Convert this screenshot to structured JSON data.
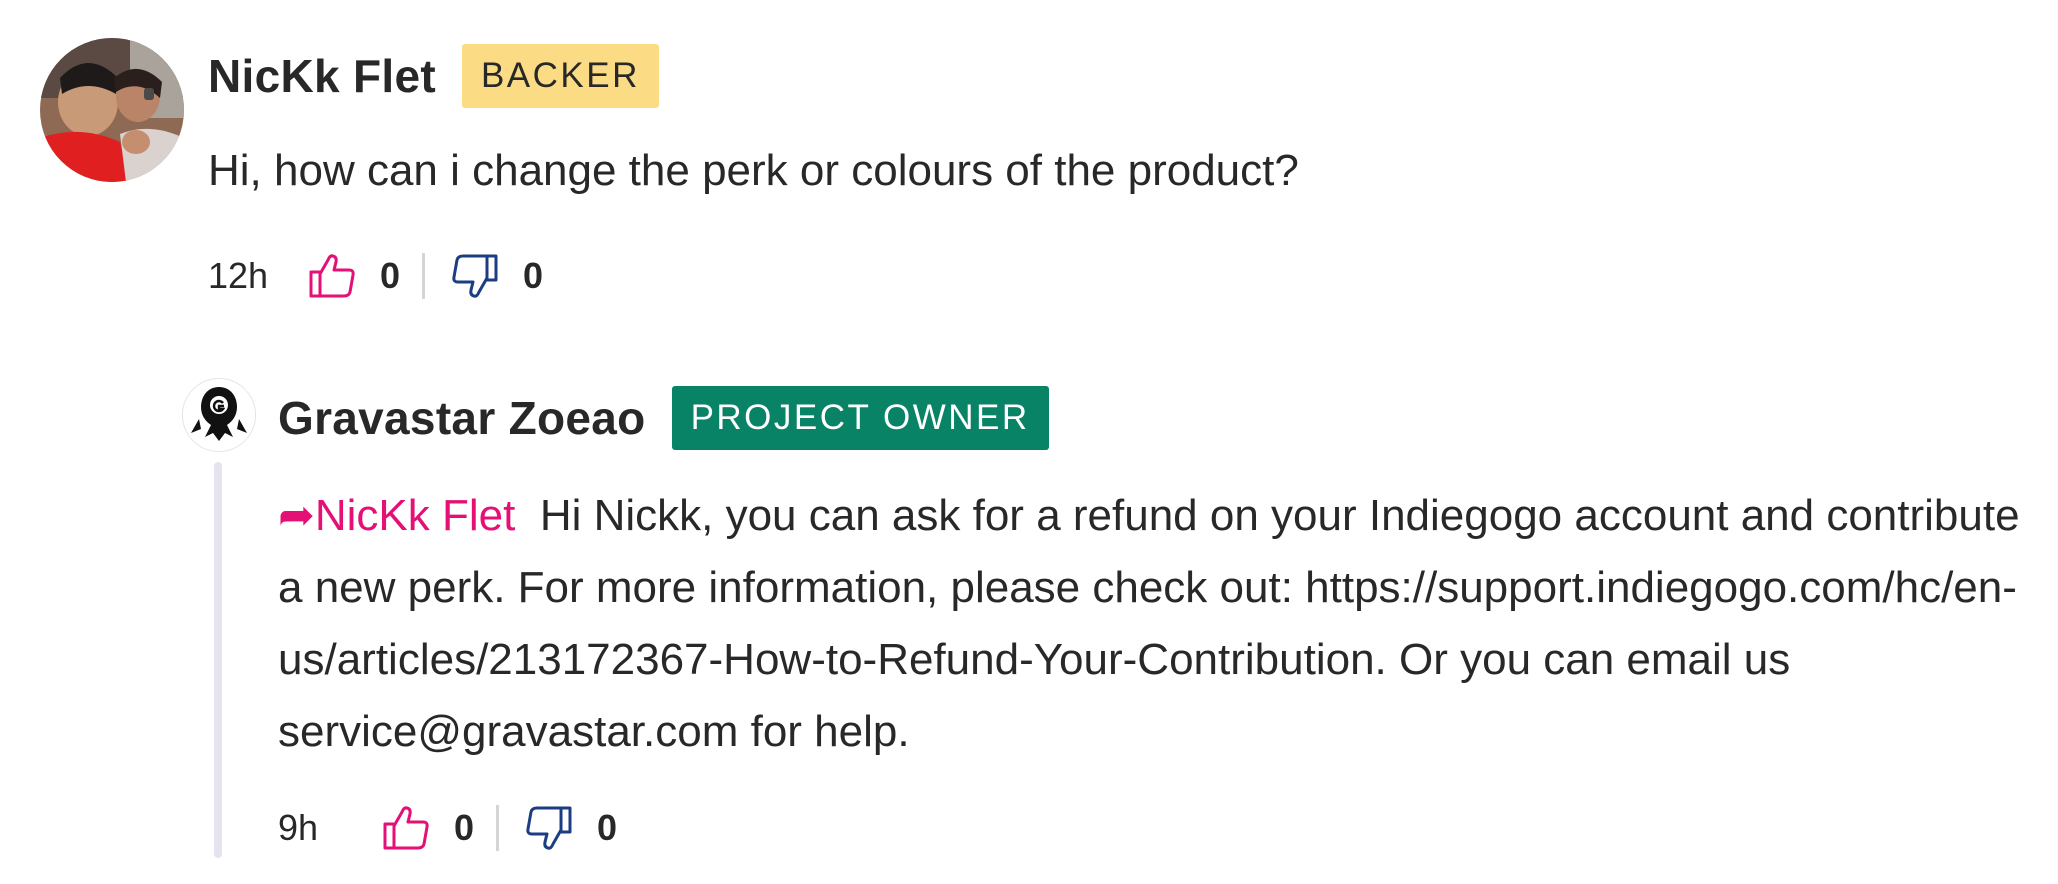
{
  "comment": {
    "author": "NicKk Flet",
    "badge": "BACKER",
    "text": "Hi, how can i change the perk or colours of the product?",
    "time": "12h",
    "upvotes": "0",
    "downvotes": "0"
  },
  "reply": {
    "author": "Gravastar Zoeao",
    "badge": "PROJECT OWNER",
    "mention": "NicKk Flet",
    "text": "Hi Nickk, you can ask for a refund on your Indiegogo account and contribute a new perk. For more information, please check out: https://support.indiegogo.com/hc/en-us/articles/213172367-How-to-Refund-Your-Contribution. Or you can email us service@gravastar.com for help.",
    "time": "9h",
    "upvotes": "0",
    "downvotes": "0"
  },
  "icons": {
    "upvote": "thumbs-up-icon",
    "downvote": "thumbs-down-icon",
    "mention": "reply-arrow-icon"
  },
  "colors": {
    "backer_badge": "#fbdc84",
    "owner_badge": "#088366",
    "upvote": "#e51075",
    "downvote": "#1b3e82",
    "mention": "#e51075"
  }
}
